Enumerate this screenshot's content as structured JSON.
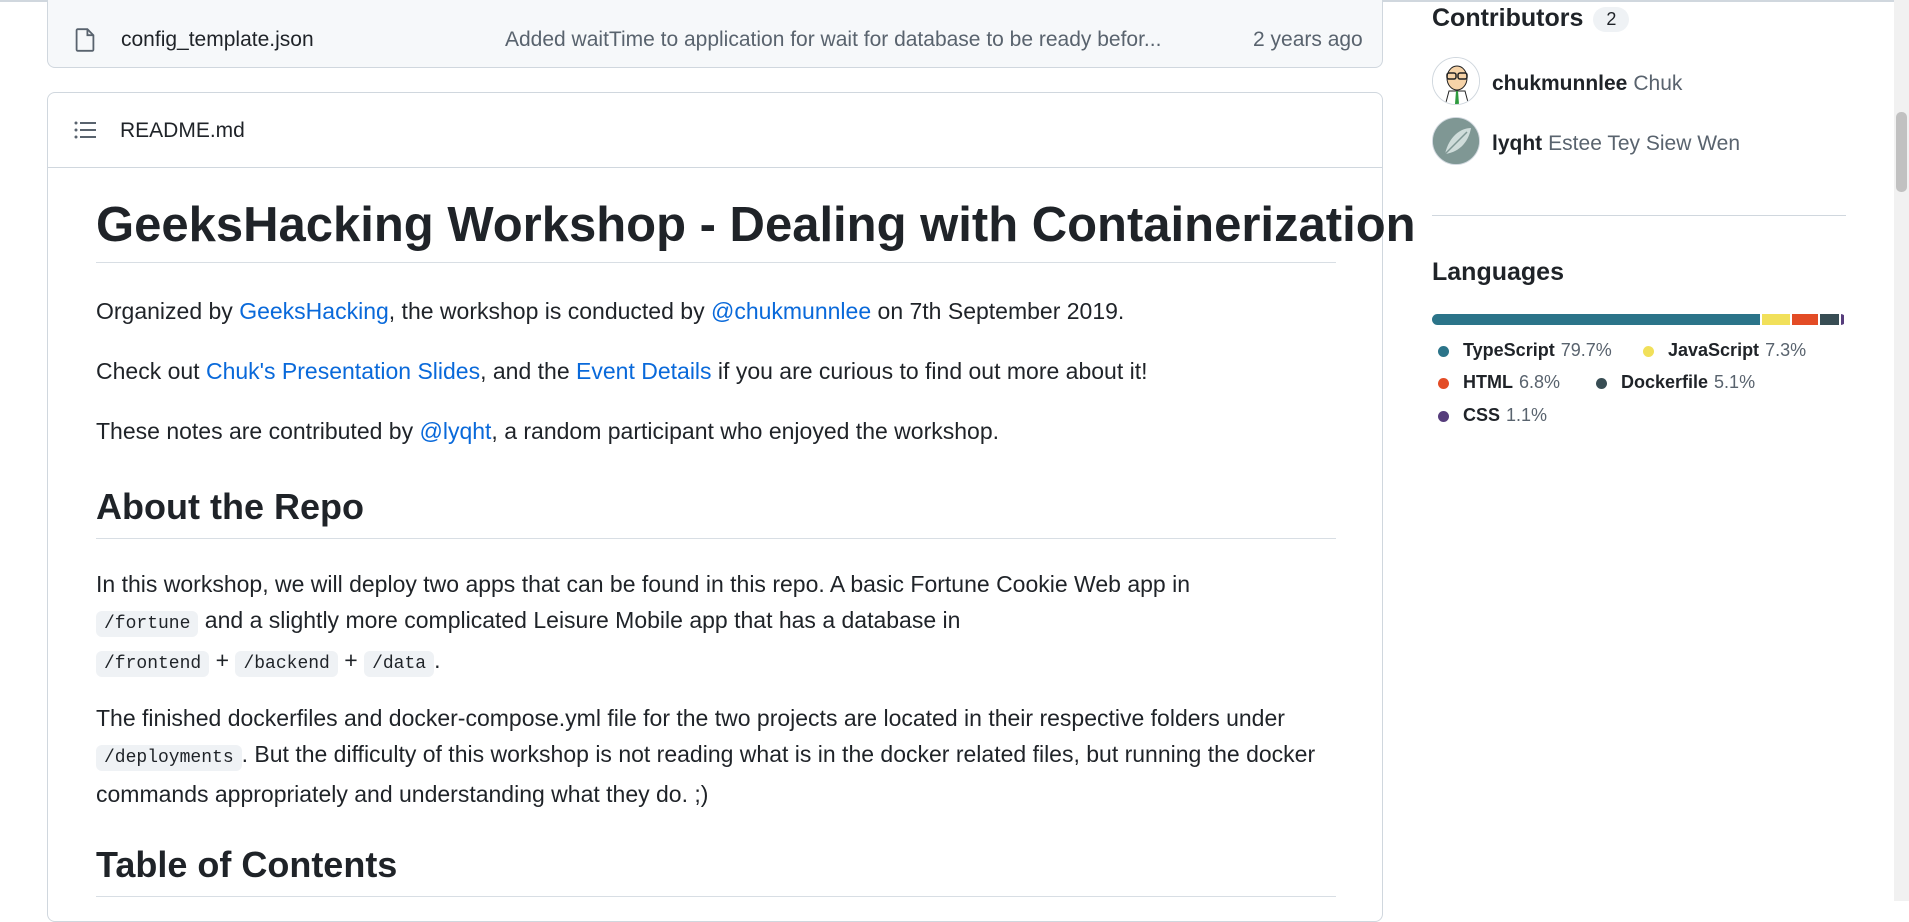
{
  "file_row": {
    "name": "config_template.json",
    "commit_message": "Added waitTime to application for wait for database to be ready befor...",
    "age": "2 years ago"
  },
  "readme": {
    "filename": "README.md",
    "title": "GeeksHacking Workshop - Dealing with Containerization",
    "p1": {
      "t1": "Organized by ",
      "link1": "GeeksHacking",
      "t2": ", the workshop is conducted by ",
      "link2": "@chukmunnlee",
      "t3": " on 7th September 2019."
    },
    "p2": {
      "t1": "Check out ",
      "link1": "Chuk's Presentation Slides",
      "t2": ", and the ",
      "link2": "Event Details",
      "t3": " if you are curious to find out more about it!"
    },
    "p3": {
      "t1": "These notes are contributed by ",
      "link1": "@lyqht",
      "t2": ", a random participant who enjoyed the workshop."
    },
    "h2_about": "About the Repo",
    "p4": {
      "t1": "In this workshop, we will deploy two apps that can be found in this repo. A basic Fortune Cookie Web app in",
      "code1": "/fortune",
      "t2": " and a slightly more complicated Leisure Mobile app that has a database in",
      "code2": "/frontend",
      "plus1": " + ",
      "code3": "/backend",
      "plus2": " + ",
      "code4": "/data",
      "t3": "."
    },
    "p5": {
      "t1": "The finished dockerfiles and docker-compose.yml file for the two projects are located in their respective folders under ",
      "code1": "/deployments",
      "t2": ". But the difficulty of this workshop is not reading what is in the docker related files, but running the docker commands appropriately and understanding what they do. ;)"
    },
    "h2_toc": "Table of Contents"
  },
  "sidebar": {
    "contributors_heading": "Contributors",
    "contributors_count": "2",
    "contributors": [
      {
        "login": "chukmunnlee",
        "name": "Chuk"
      },
      {
        "login": "lyqht",
        "name": "Estee Tey Siew Wen"
      }
    ],
    "languages_heading": "Languages",
    "languages": [
      {
        "name": "TypeScript",
        "percent": "79.7%",
        "value": 79.7,
        "color": "#3178c6",
        "bar_color": "#2b7489"
      },
      {
        "name": "JavaScript",
        "percent": "7.3%",
        "value": 7.3,
        "color": "#f1e05a",
        "bar_color": "#f1e05a"
      },
      {
        "name": "HTML",
        "percent": "6.8%",
        "value": 6.8,
        "color": "#e34c26",
        "bar_color": "#e34c26"
      },
      {
        "name": "Dockerfile",
        "percent": "5.1%",
        "value": 5.1,
        "color": "#384d54",
        "bar_color": "#384d54"
      },
      {
        "name": "CSS",
        "percent": "1.1%",
        "value": 1.1,
        "color": "#563d7c",
        "bar_color": "#563d7c"
      }
    ]
  }
}
